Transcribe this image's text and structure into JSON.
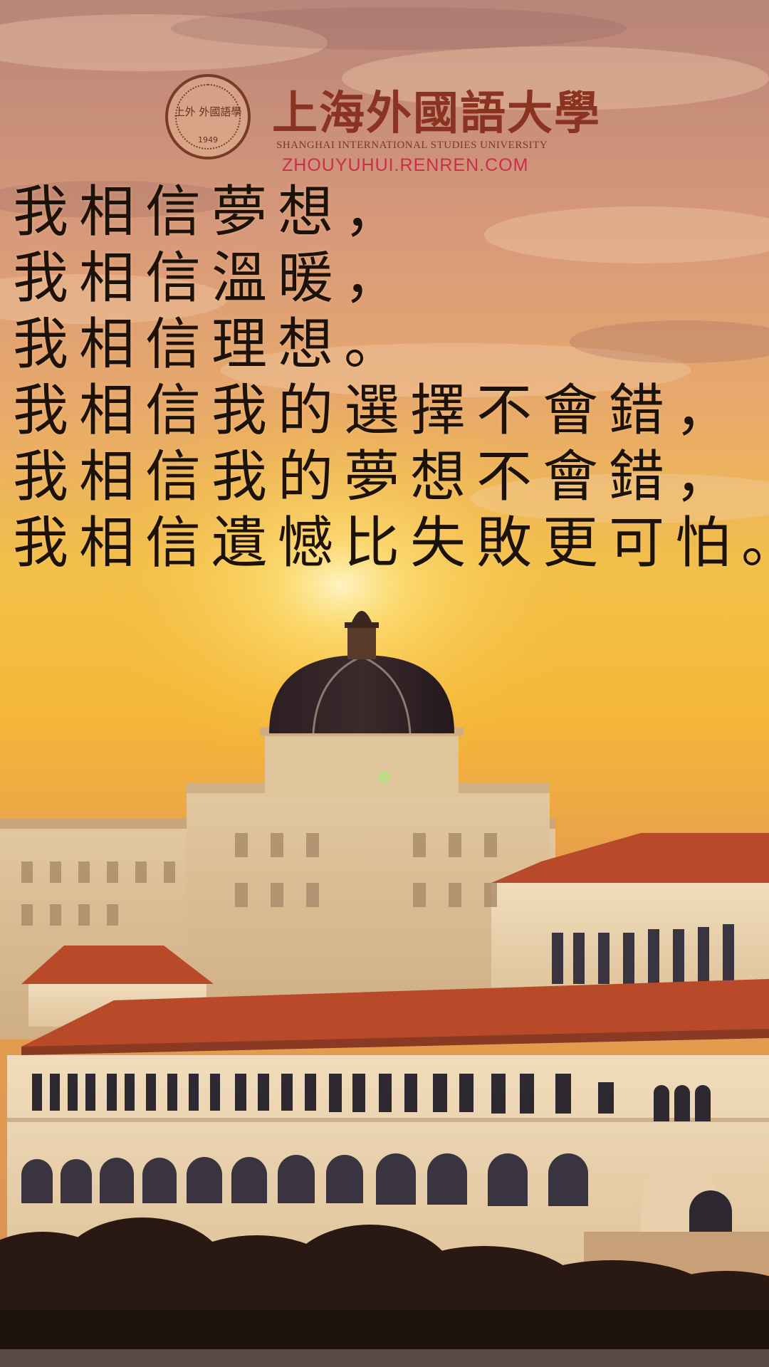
{
  "logo": {
    "seal_text": "上外 外國語學",
    "seal_year": "1949",
    "name_cn": "上海外國語大學",
    "name_en": "SHANGHAI INTERNATIONAL STUDIES UNIVERSITY",
    "watermark_url": "ZHOUYUHUI.RENREN.COM"
  },
  "poem": {
    "lines": [
      "我相信夢想，",
      "我相信溫暖，",
      "我相信理想。",
      "我相信我的選擇不會錯，",
      "我相信我的夢想不會錯，",
      "我相信遺憾比失敗更可怕。"
    ]
  },
  "colors": {
    "sky_top": "#b9857a",
    "sky_glow": "#f6c640",
    "roof": "#b84a2a",
    "building": "#e8d2ae",
    "dome": "#2a1c20",
    "text": "#1c120a"
  }
}
